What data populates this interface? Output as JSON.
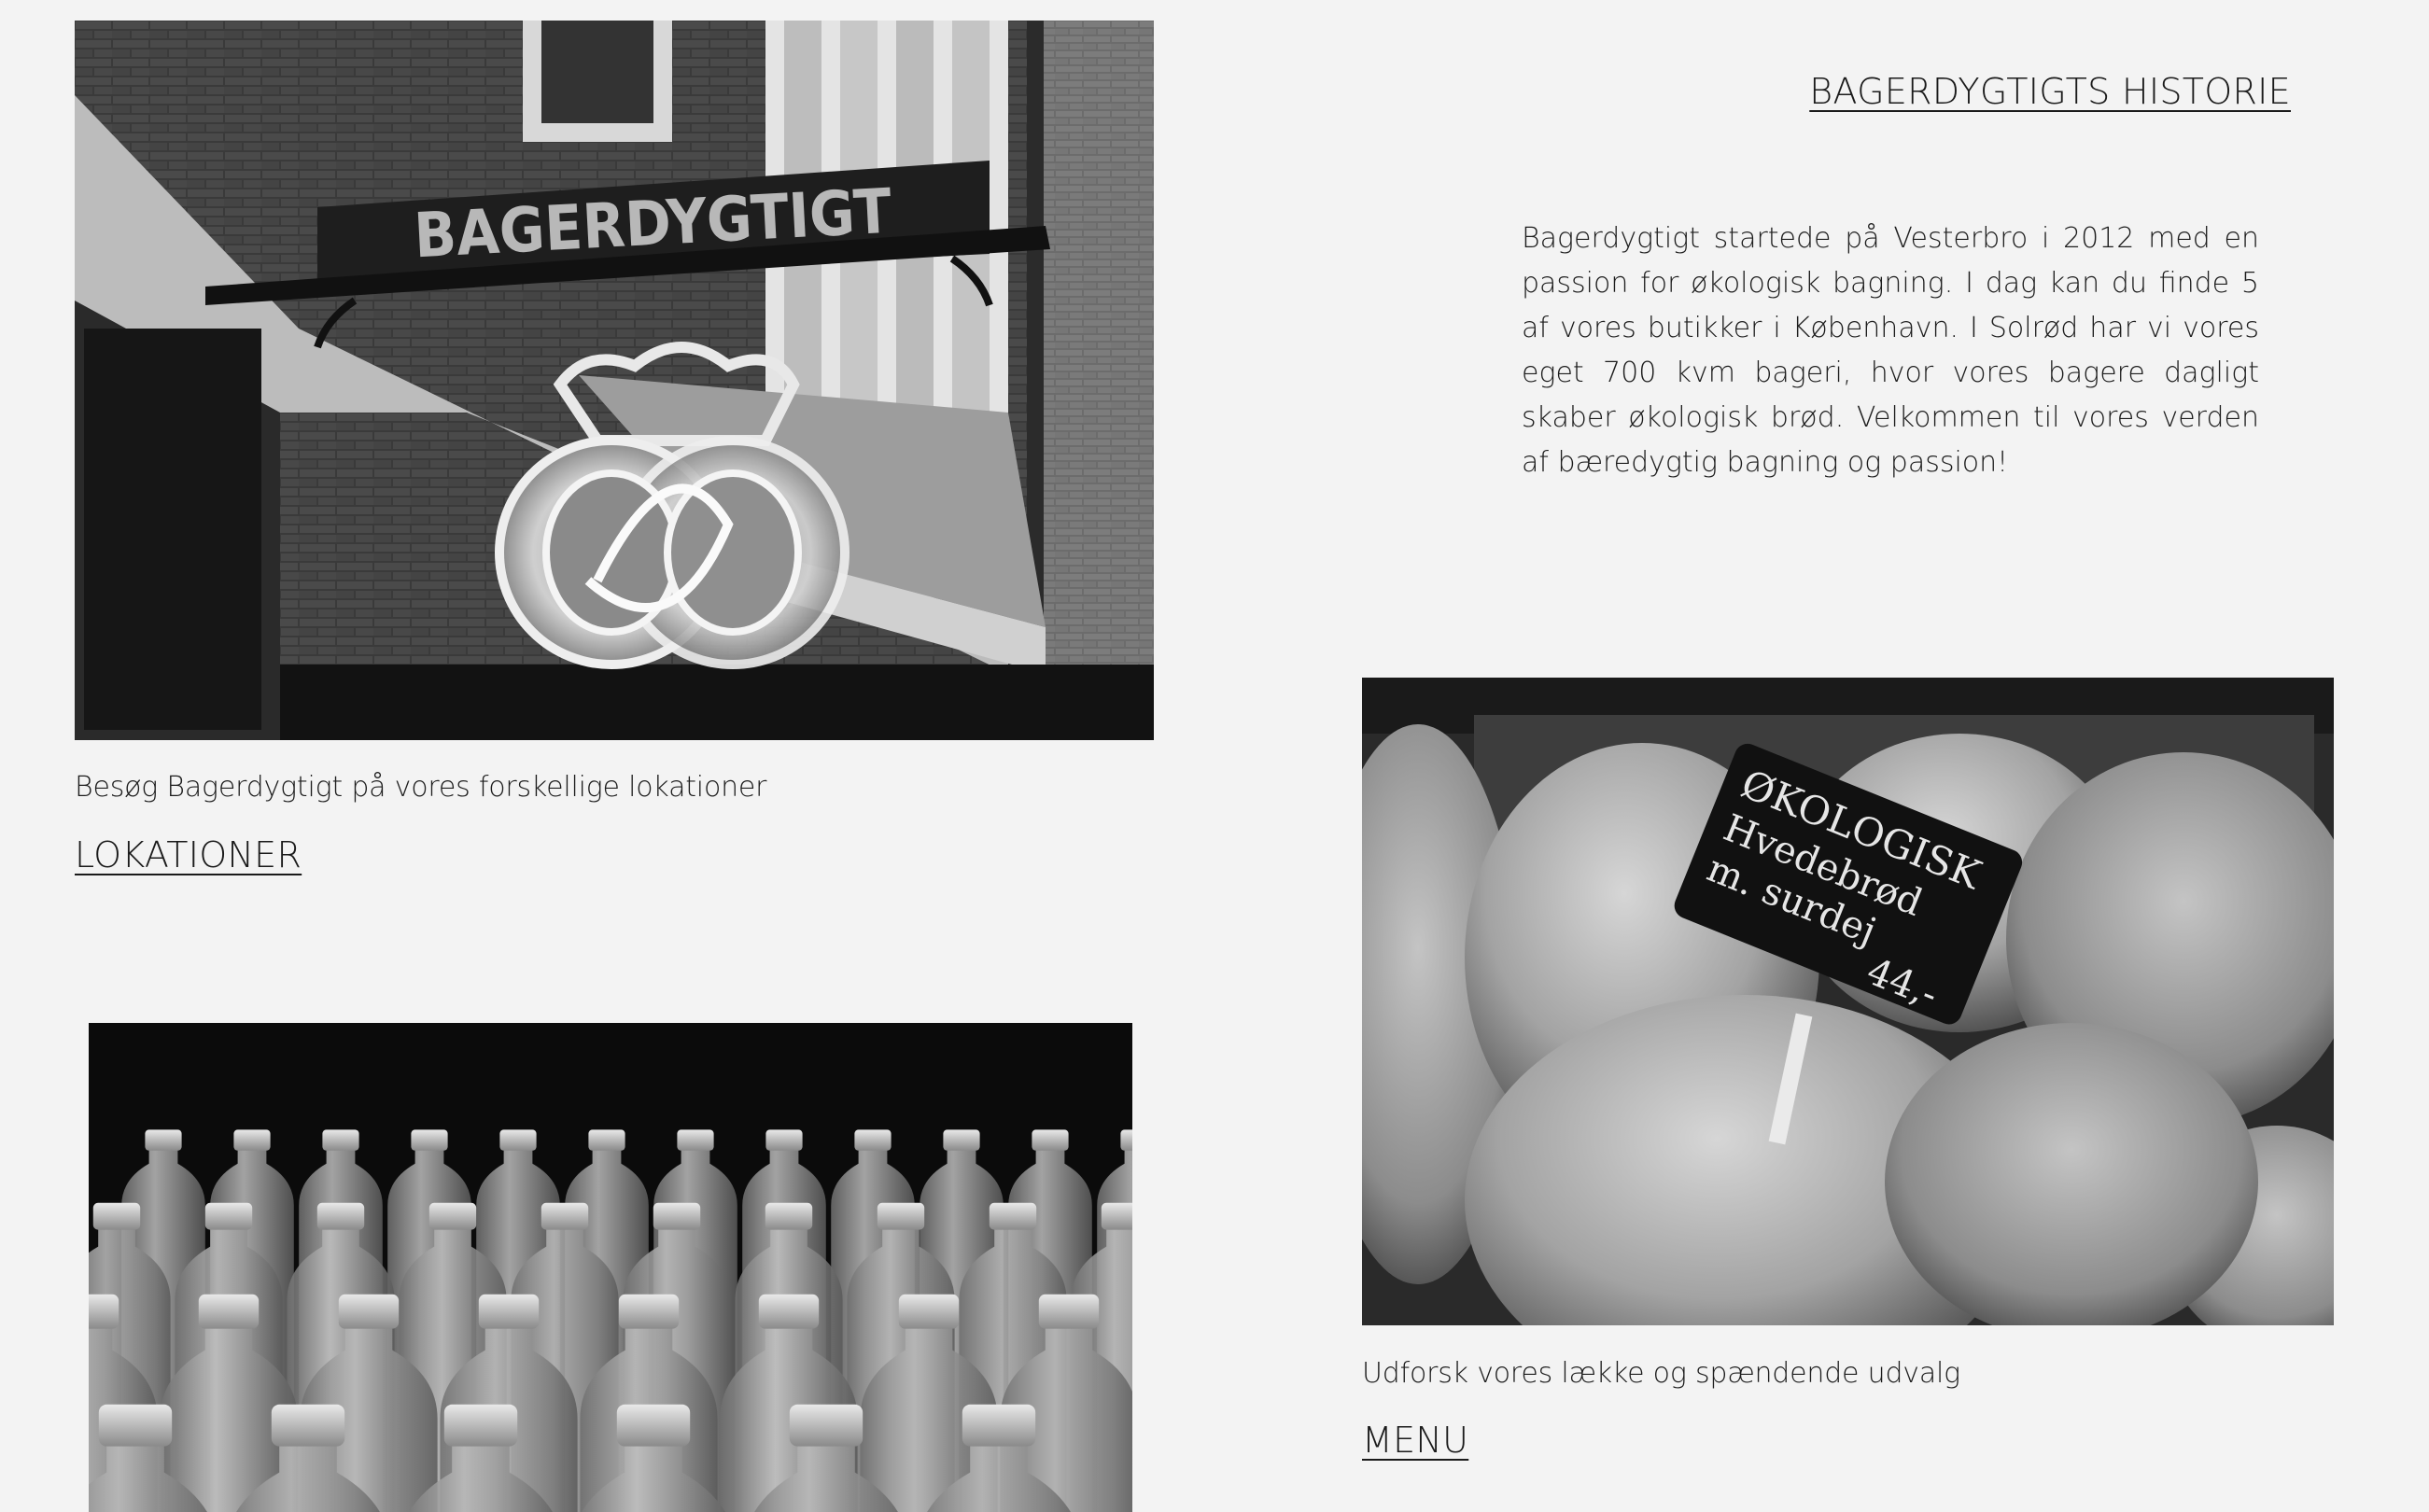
{
  "history": {
    "title": "BAGERDYGTIGTS HISTORIE",
    "text": "Bagerdygtigt startede på Vesterbro i 2012 med en passion for økologisk bagning. I dag kan du finde 5 af vores butikker i København. I Solrød har vi vores eget 700 kvm bageri, hvor vores bagere dagligt skaber økologisk brød. Velkommen til vores verden af bæredygtig bagning og passion!"
  },
  "locations": {
    "sign_text": "BAGERDYGTIGT",
    "caption": "Besøg Bagerdygtigt på vores forskellige lokationer",
    "link_label": "LOKATIONER"
  },
  "menu": {
    "price_tag": {
      "line1": "ØKOLOGISK",
      "line2": "Hvedebrød",
      "line3": "m. surdej",
      "price": "44,-"
    },
    "caption": "Udforsk vores lække og spændende udvalg",
    "link_label": "MENU"
  },
  "colors": {
    "background": "#f3f3f3",
    "text": "#1a1a1a"
  }
}
